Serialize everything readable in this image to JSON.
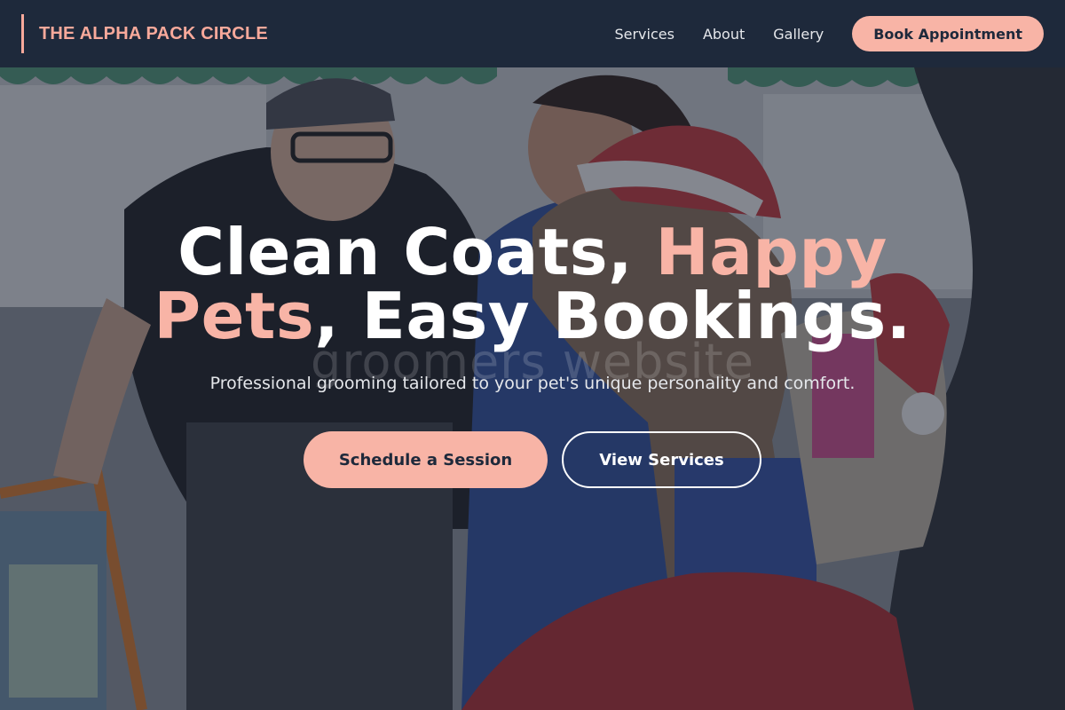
{
  "header": {
    "brand": "THE ALPHA PACK CIRCLE",
    "nav": [
      {
        "label": "Services"
      },
      {
        "label": "About"
      },
      {
        "label": "Gallery"
      }
    ],
    "book_button": "Book Appointment"
  },
  "hero": {
    "headline_part1": "Clean Coats, ",
    "headline_accent1": "Happy",
    "headline_accent2": "Pets",
    "headline_part2": ", Easy Bookings.",
    "watermark": "groomers website",
    "subtitle": "Professional grooming tailored to your pet's unique personality and comfort.",
    "primary_cta": "Schedule a Session",
    "secondary_cta": "View Services"
  },
  "colors": {
    "accent": "#f8b4a6",
    "nav_background": "#1e293b",
    "text_light": "#ffffff"
  }
}
